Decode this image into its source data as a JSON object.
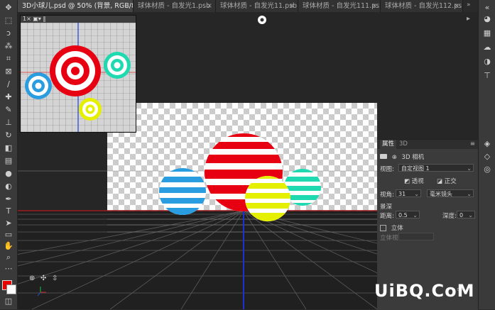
{
  "tabs": [
    {
      "label": "3D小球儿.psd @ 50% (背景, RGB/8#) *",
      "active": true
    },
    {
      "label": "球体材质 - 自发光1.psb",
      "active": false
    },
    {
      "label": "球体材质 - 自发光11.psb",
      "active": false
    },
    {
      "label": "球体材质 - 自发光111.psb",
      "active": false
    },
    {
      "label": "球体材质 - 自发光112.psb",
      "active": false
    }
  ],
  "tab_close": "×",
  "mini_header": "1× ▣▾ ‖",
  "props": {
    "tab_properties": "属性",
    "tab_3d": "3D",
    "menu": "≡",
    "title": "3D 相机",
    "view_label": "视图:",
    "view_value": "自定视图 1",
    "perspective": "透视",
    "orthographic": "正交",
    "fov_label": "视角:",
    "fov_value": "31",
    "lens_value": "毫米镜头",
    "dof_label": "景深",
    "distance_label": "距离:",
    "distance_value": "0.5",
    "depth_label": "深度:",
    "depth_value": "0",
    "stereo_label": "立体",
    "stereo_view_label": "立体视图:"
  },
  "watermark": "UiBQ.CoM",
  "colors": {
    "red": "#e60012",
    "blue": "#2a9de0",
    "yellow": "#e4f000",
    "teal": "#1fd9b0",
    "foreground": "#e80000",
    "background": "#ffffff"
  }
}
